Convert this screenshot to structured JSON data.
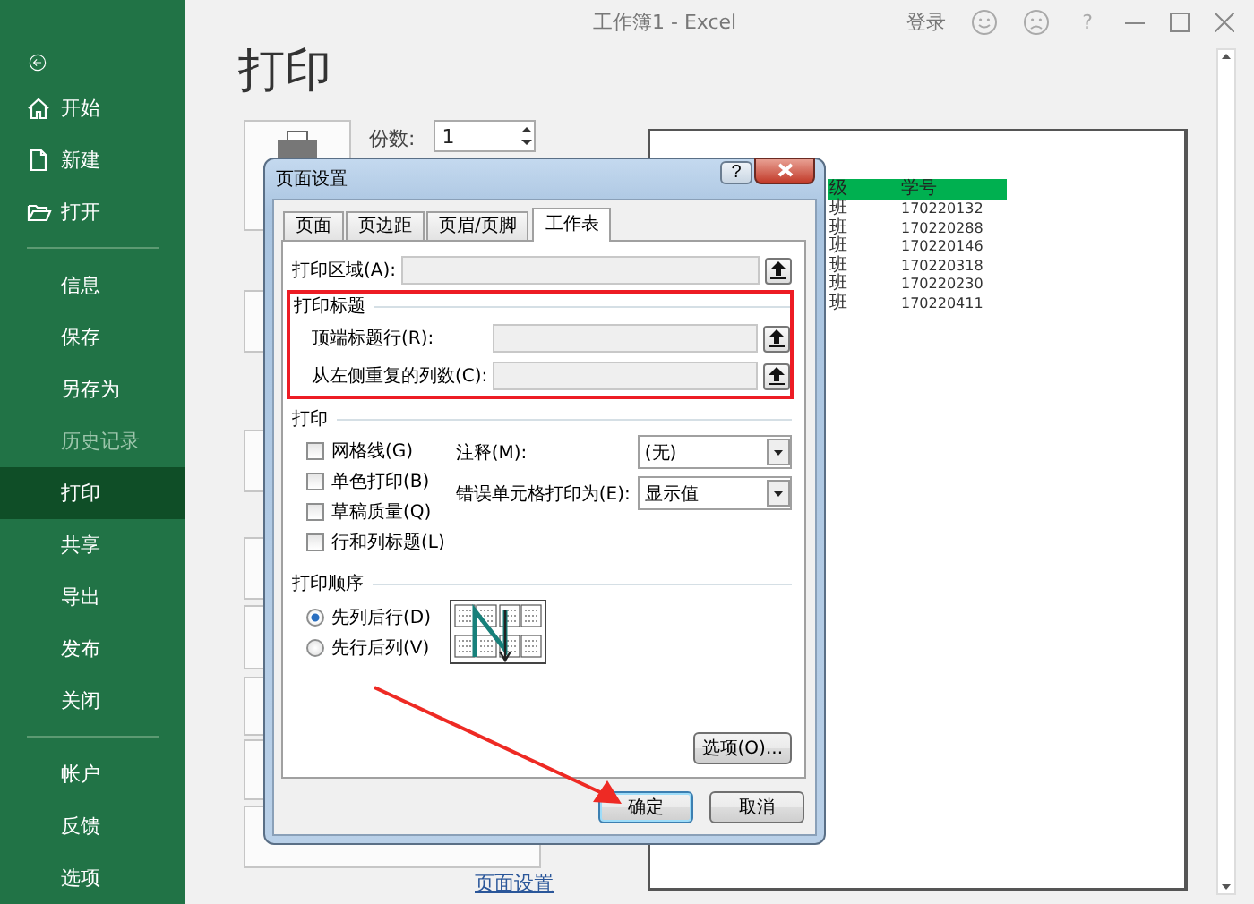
{
  "window": {
    "title": "工作簿1 - Excel",
    "sign_in": "登录",
    "help": "?"
  },
  "sidebar": {
    "groups": [
      {
        "items": [
          {
            "label": "开始",
            "selected": false,
            "disabled": false
          },
          {
            "label": "新建",
            "selected": false,
            "disabled": false
          },
          {
            "label": "打开",
            "selected": false,
            "disabled": false
          }
        ]
      },
      {
        "items": [
          {
            "label": "信息",
            "selected": false,
            "disabled": false
          },
          {
            "label": "保存",
            "selected": false,
            "disabled": false
          },
          {
            "label": "另存为",
            "selected": false,
            "disabled": false
          },
          {
            "label": "历史记录",
            "selected": false,
            "disabled": true
          },
          {
            "label": "打印",
            "selected": true,
            "disabled": false
          },
          {
            "label": "共享",
            "selected": false,
            "disabled": false
          },
          {
            "label": "导出",
            "selected": false,
            "disabled": false
          },
          {
            "label": "发布",
            "selected": false,
            "disabled": false
          },
          {
            "label": "关闭",
            "selected": false,
            "disabled": false
          }
        ]
      },
      {
        "items": [
          {
            "label": "帐户",
            "selected": false,
            "disabled": false
          },
          {
            "label": "反馈",
            "selected": false,
            "disabled": false
          },
          {
            "label": "选项",
            "selected": false,
            "disabled": false
          }
        ]
      }
    ]
  },
  "backstage": {
    "heading": "打印",
    "copies_label": "份数:",
    "copies": "1",
    "page_setup_link": "页面设置"
  },
  "preview": {
    "header": [
      "级",
      "学号"
    ],
    "rows": [
      [
        "班",
        "170220132"
      ],
      [
        "班",
        "170220288"
      ],
      [
        "班",
        "170220146"
      ],
      [
        "班",
        "170220318"
      ],
      [
        "班",
        "170220230"
      ],
      [
        "班",
        "170220411"
      ]
    ]
  },
  "dialog": {
    "title": "页面设置",
    "help": "?",
    "tabs": [
      {
        "label": "页面",
        "selected": false
      },
      {
        "label": "页边距",
        "selected": false
      },
      {
        "label": "页眉/页脚",
        "selected": false
      },
      {
        "label": "工作表",
        "selected": true
      }
    ],
    "print_area_label": "打印区域(A):",
    "print_titles": {
      "title": "打印标题",
      "rows": [
        "顶端标题行(R):",
        "从左侧重复的列数(C):"
      ]
    },
    "print": {
      "title": "打印",
      "options": [
        {
          "label": "网格线(G)",
          "checked": false
        },
        {
          "label": "单色打印(B)",
          "checked": false
        },
        {
          "label": "草稿质量(Q)",
          "checked": false
        },
        {
          "label": "行和列标题(L)",
          "checked": false
        }
      ],
      "comments_label": "注释(M):",
      "comments_value": "(无)",
      "errors_label": "错误单元格打印为(E):",
      "errors_value": "显示值"
    },
    "page_order": {
      "title": "打印顺序",
      "options": [
        {
          "label": "先列后行(D)",
          "selected": true
        },
        {
          "label": "先行后列(V)",
          "selected": false
        }
      ]
    },
    "options_button": "选项(O)...",
    "ok": "确定",
    "cancel": "取消"
  }
}
